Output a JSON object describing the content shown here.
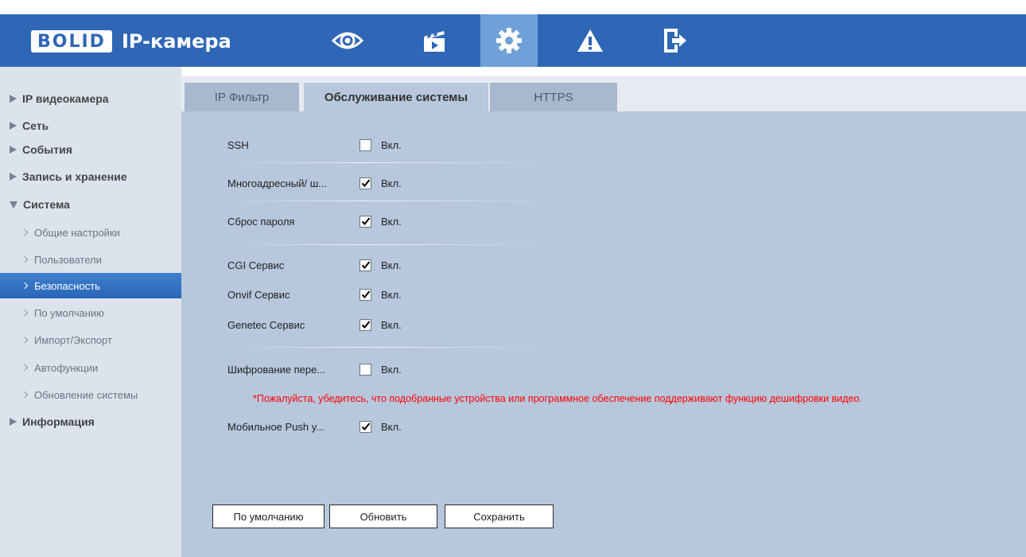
{
  "header": {
    "logo": "BOLID",
    "title": "IP-камера",
    "nav_icons": [
      "eye-icon",
      "clapperboard-icon",
      "gear-icon",
      "warning-icon",
      "logout-icon"
    ],
    "active_nav": "gear-icon"
  },
  "sidebar": {
    "items": [
      {
        "label": "IP видеокамера",
        "type": "section",
        "expanded": false
      },
      {
        "label": "Сеть",
        "type": "section",
        "expanded": false
      },
      {
        "label": "События",
        "type": "section",
        "expanded": false
      },
      {
        "label": "Запись и хранение",
        "type": "section",
        "expanded": false
      },
      {
        "label": "Система",
        "type": "section",
        "expanded": true
      },
      {
        "label": "Общие настройки",
        "type": "sub"
      },
      {
        "label": "Пользователи",
        "type": "sub"
      },
      {
        "label": "Безопасность",
        "type": "sub",
        "active": true
      },
      {
        "label": "По умолчанию",
        "type": "sub"
      },
      {
        "label": "Импорт/Экспорт",
        "type": "sub"
      },
      {
        "label": "Автофункции",
        "type": "sub"
      },
      {
        "label": "Обновление системы",
        "type": "sub"
      },
      {
        "label": "Информация",
        "type": "section",
        "expanded": false
      }
    ]
  },
  "tabs": [
    {
      "label": "IP Фильтр",
      "active": false
    },
    {
      "label": "Обслуживание системы",
      "active": true
    },
    {
      "label": "HTTPS",
      "active": false
    }
  ],
  "settings": [
    {
      "label": "SSH",
      "checked": false,
      "option": "Вкл."
    },
    {
      "label": "Многоадресный/ ш...",
      "checked": true,
      "option": "Вкл."
    },
    {
      "label": "Сброс пароля",
      "checked": true,
      "option": "Вкл."
    },
    {
      "label": "CGI Сервис",
      "checked": true,
      "option": "Вкл."
    },
    {
      "label": "Onvif Сервис",
      "checked": true,
      "option": "Вкл."
    },
    {
      "label": "Genetec Сервис",
      "checked": true,
      "option": "Вкл."
    },
    {
      "label": "Шифрование пере...",
      "checked": false,
      "option": "Вкл."
    },
    {
      "label": "Мобильное Push у...",
      "checked": true,
      "option": "Вкл."
    }
  ],
  "warning": "*Пожалуйста, убедитесь, что подобранные устройства или программное обеспечение поддерживают функцию дешифровки видео.",
  "buttons": {
    "default": "По умолчанию",
    "refresh": "Обновить",
    "save": "Сохранить"
  },
  "colors": {
    "header": "#2f66b6",
    "sidebar": "#dde3ec",
    "content": "#b7c7dc",
    "active_item": "#2b66b8",
    "warning": "#ff0000"
  }
}
